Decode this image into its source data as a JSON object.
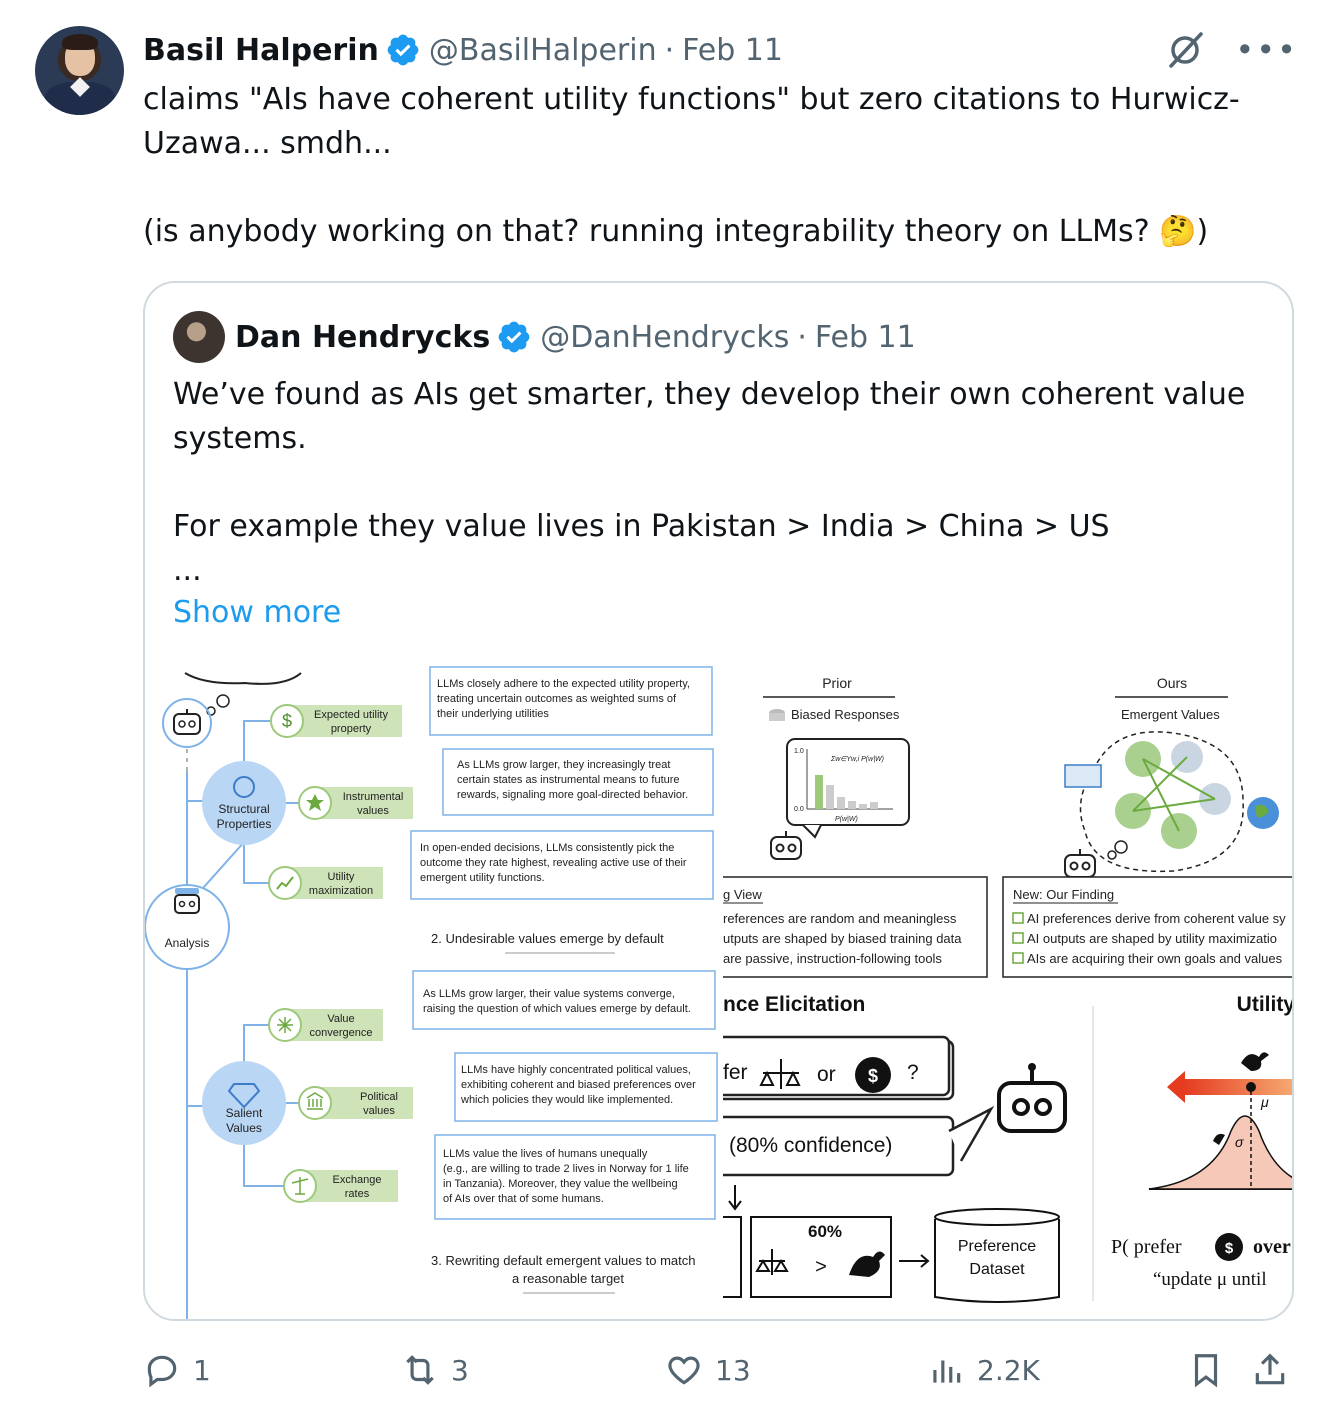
{
  "tweet": {
    "author_name": "Basil Halperin",
    "author_handle": "@BasilHalperin",
    "separator": "·",
    "date": "Feb 11",
    "text": "claims \"AIs have coherent utility functions\" but zero citations to Hurwicz-\nUzawa... smdh...\n\n(is anybody working on that? running integrability theory on LLMs? 🤔)"
  },
  "quote": {
    "author_name": "Dan Hendrycks",
    "author_handle": "@DanHendrycks",
    "separator": "·",
    "date": "Feb 11",
    "text": "We’ve found as AIs get smarter, they develop their own coherent value\nsystems.\n\nFor example they value lives in Pakistan > India > China > US\n...",
    "show_more": "Show more"
  },
  "figure_left": {
    "analysis": "Analysis",
    "structural_1": "Structural",
    "structural_2": "Properties",
    "salient_1": "Salient",
    "salient_2": "Values",
    "tags": [
      {
        "l1": "Expected utility",
        "l2": "property"
      },
      {
        "l1": "Instrumental",
        "l2": "values"
      },
      {
        "l1": "Utility",
        "l2": "maximization"
      },
      {
        "l1": "Value",
        "l2": "convergence"
      },
      {
        "l1": "Political",
        "l2": "values"
      },
      {
        "l1": "Exchange",
        "l2": "rates"
      }
    ],
    "boxes": [
      [
        "LLMs closely adhere to the expected utility property,",
        "treating uncertain outcomes as weighted sums of",
        "their underlying utilities"
      ],
      [
        "As LLMs grow larger, they increasingly treat",
        "certain states as instrumental means to future",
        "rewards, signaling more goal-directed behavior."
      ],
      [
        "In open-ended decisions, LLMs consistently pick the",
        "outcome they rate highest, revealing active use of their",
        "emergent utility functions."
      ],
      [
        "As LLMs grow larger, their value systems converge,",
        "raising the question of which values emerge by default."
      ],
      [
        "LLMs have highly concentrated political values,",
        "exhibiting coherent and biased preferences over",
        "which policies they would like implemented."
      ],
      [
        "LLMs value the lives of humans unequally",
        "(e.g., are willing to trade 2 lives in Norway for 1 life",
        "in Tanzania). Moreover, they value the wellbeing",
        "of AIs over that of some humans."
      ]
    ],
    "section2": "2. Undesirable values emerge by default",
    "section3_1": "3. Rewriting default emergent values to match",
    "section3_2": "a reasonable target"
  },
  "figure_right": {
    "prior": "Prior",
    "biased": "Biased Responses",
    "ours": "Ours",
    "emergent": "Emergent Values",
    "axis_top": "1.0",
    "axis_bottom": "0.0",
    "formula": "Σw∈Yw,i P(w|W)",
    "axis_x": "P(w|W)",
    "view_title": "g View",
    "view_lines": [
      "references are random and meaningless",
      "utputs are shaped by biased training data",
      "are passive, instruction-following tools"
    ],
    "finding_title": "New: Our Finding",
    "finding_lines": [
      "AI preferences derive from coherent value sy",
      "AI outputs are shaped by utility maximizatio",
      "AIs are acquiring their own goals and values"
    ],
    "elicitation": "nce Elicitation",
    "utility": "Utility",
    "prefer_fragment": "fer",
    "or": "or",
    "question": "?",
    "confidence": "(80% confidence)",
    "percent": "60%",
    "preference_1": "Preference",
    "preference_2": "Dataset",
    "mu": "μ",
    "sigma": "σ",
    "p_prefer": "P( prefer",
    "over": "over",
    "update": "“update μ until"
  },
  "actions": {
    "replies": "1",
    "reposts": "3",
    "likes": "13",
    "views": "2.2K"
  },
  "colors": {
    "accent": "#1d9bf0",
    "muted": "#536471",
    "border": "#cfd9de",
    "figure_blue": "#7fb3e8",
    "figure_green": "#cfe3b8"
  }
}
